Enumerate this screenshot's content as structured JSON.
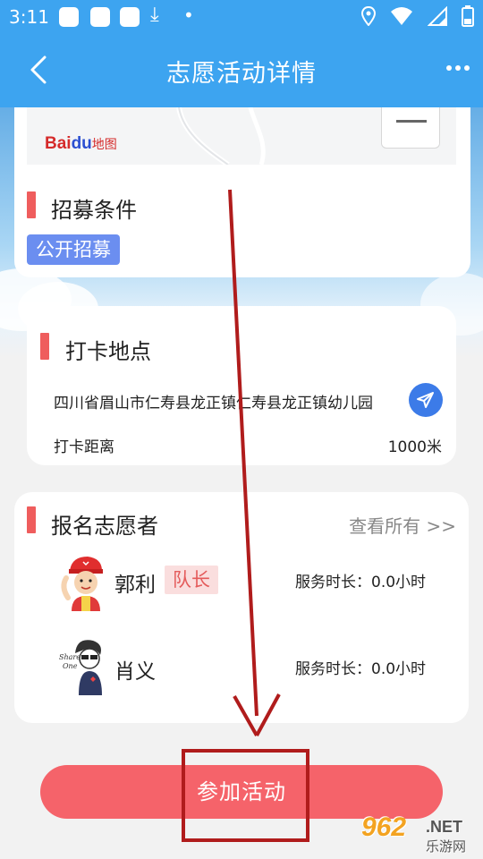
{
  "status_bar": {
    "time": "3:11",
    "download_icon": "download-icon"
  },
  "header": {
    "title": "志愿活动详情",
    "back_icon": "chevron-left-icon",
    "more_icon": "more-dots-icon"
  },
  "map": {
    "logo_text": "Bai",
    "logo_du": "du",
    "logo_ditu": "地图"
  },
  "recruit": {
    "section_title": "招募条件",
    "tag": "公开招募"
  },
  "checkin": {
    "section_title": "打卡地点",
    "address": "四川省眉山市仁寿县龙正镇仁寿县龙正镇幼儿园",
    "distance_label": "打卡距离",
    "distance_value": "1000米"
  },
  "volunteers": {
    "section_title": "报名志愿者",
    "view_all": "查看所有 >>",
    "items": [
      {
        "name": "郭利",
        "badge": "队长",
        "service_label": "服务时长：",
        "service_value": "0.0小时"
      },
      {
        "name": "肖义",
        "badge": "",
        "service_label": "服务时长：",
        "service_value": "0.0小时"
      }
    ]
  },
  "join_button": "参加活动",
  "watermark": {
    "num": "962",
    "net": ".NET",
    "cn": "乐游网"
  },
  "colors": {
    "primary": "#3da4f0",
    "accent_red": "#f5636a",
    "section_bar": "#ef5d5d",
    "tag_blue": "#6b8ef0",
    "annotation": "#b01c1c"
  }
}
